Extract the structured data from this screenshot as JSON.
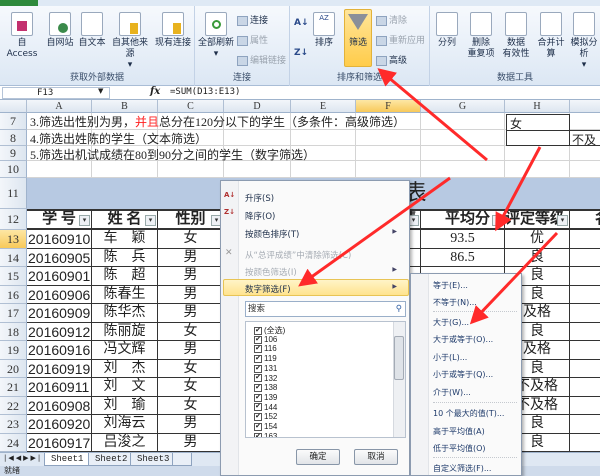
{
  "accent": {
    "arrow": "#ff2a2a",
    "highlight": "#ffe38e",
    "title_band": "#b7c9e2"
  },
  "ribbon": {
    "groups": [
      {
        "label": "获取外部数据",
        "buttons": [
          "自 Access",
          "自网站",
          "自文本",
          "自其他来源"
        ],
        "extra": "现有连接"
      },
      {
        "label": "连接",
        "buttons": [
          "全部刷新"
        ],
        "small": [
          "连接",
          "属性",
          "编辑链接"
        ]
      },
      {
        "label": "排序和筛选",
        "buttons": [
          "排序",
          "筛选"
        ],
        "small": [
          "清除",
          "重新应用",
          "高级"
        ]
      },
      {
        "label": "数据工具",
        "buttons": [
          "分列",
          "删除\n重复项",
          "数据\n有效性",
          "合并计算",
          "模拟分析"
        ]
      }
    ]
  },
  "formula_bar": {
    "name_box": "F13",
    "fx": "fx",
    "formula": "=SUM(D13:E13)"
  },
  "columns": [
    "A",
    "B",
    "C",
    "D",
    "E",
    "F",
    "G",
    "H",
    "I"
  ],
  "selected_column": "F",
  "notes": [
    {
      "row": "7",
      "parts": [
        "3.筛选出性别为男，",
        "并且",
        "总分在120分以下的学生（多条件：高级筛选）"
      ]
    },
    {
      "row": "8",
      "parts": [
        "4.筛选出姓陈的学生（文本筛选）"
      ]
    },
    {
      "row": "9",
      "parts": [
        "5.筛选出机试成绩在80到90分之间的学生（数字筛选）"
      ]
    }
  ],
  "side_cells": {
    "h7": "女",
    "i8": "不及"
  },
  "table": {
    "title": "成绩表",
    "headers": [
      "学 号",
      "姓 名",
      "性别",
      "",
      "",
      "总评成绩",
      "平均分",
      "评定等级",
      "名次"
    ],
    "rows": [
      {
        "n": "13",
        "id": "20160910",
        "name": "车　颖",
        "sex": "女",
        "avg": "93.5",
        "grade": "优",
        "rank": ""
      },
      {
        "n": "14",
        "id": "20160905",
        "name": "陈　兵",
        "sex": "男",
        "avg": "86.5",
        "grade": "良",
        "rank": ""
      },
      {
        "n": "15",
        "id": "20160901",
        "name": "陈　超",
        "sex": "男",
        "avg": "",
        "grade": "良",
        "rank": ""
      },
      {
        "n": "16",
        "id": "20160906",
        "name": "陈春生",
        "sex": "男",
        "avg": "",
        "grade": "良",
        "rank": "1"
      },
      {
        "n": "17",
        "id": "20160909",
        "name": "陈华杰",
        "sex": "男",
        "avg": "",
        "grade": "及格",
        "rank": "1"
      },
      {
        "n": "18",
        "id": "20160912",
        "name": "陈丽旋",
        "sex": "女",
        "avg": "",
        "grade": "良",
        "rank": ""
      },
      {
        "n": "19",
        "id": "20160916",
        "name": "冯文辉",
        "sex": "男",
        "avg": "",
        "grade": "及格",
        "rank": "1"
      },
      {
        "n": "20",
        "id": "20160919",
        "name": "刘　杰",
        "sex": "女",
        "avg": "",
        "grade": "良",
        "rank": "1"
      },
      {
        "n": "21",
        "id": "20160911",
        "name": "刘　文",
        "sex": "女",
        "avg": "",
        "grade": "不及格",
        "rank": "2"
      },
      {
        "n": "22",
        "id": "20160908",
        "name": "刘　瑜",
        "sex": "女",
        "avg": "",
        "grade": "不及格",
        "rank": "1"
      },
      {
        "n": "23",
        "id": "20160920",
        "name": "刘海云",
        "sex": "男",
        "avg": "",
        "grade": "良",
        "rank": ""
      },
      {
        "n": "24",
        "id": "20160917",
        "name": "吕浚之",
        "sex": "男",
        "avg": "",
        "grade": "良",
        "rank": ""
      }
    ]
  },
  "filter_menu": {
    "items": [
      {
        "label": "升序(S)",
        "icon": "sort-asc-icon"
      },
      {
        "label": "降序(O)",
        "icon": "sort-desc-icon"
      },
      {
        "label": "按颜色排序(T)",
        "submenu": true
      },
      {
        "label": "从“总评成绩”中清除筛选(C)",
        "disabled": true,
        "icon": "clear-filter-icon"
      },
      {
        "label": "按颜色筛选(I)",
        "disabled": true,
        "submenu": true
      },
      {
        "label": "数字筛选(F)",
        "submenu": true,
        "highlighted": true
      }
    ],
    "search_placeholder": "搜索",
    "values": [
      "(全选)",
      "106",
      "116",
      "119",
      "131",
      "132",
      "138",
      "139",
      "144",
      "152",
      "154",
      "163"
    ],
    "ok": "确定",
    "cancel": "取消"
  },
  "number_filter_submenu": [
    "等于(E)...",
    "不等于(N)...",
    "大于(G)...",
    "大于或等于(O)...",
    "小于(L)...",
    "小于或等于(Q)...",
    "介于(W)...",
    "10 个最大的值(T)...",
    "高于平均值(A)",
    "低于平均值(O)",
    "自定义筛选(F)..."
  ],
  "sheets": [
    "Sheet1",
    "Sheet2",
    "Sheet3"
  ],
  "active_sheet": "Sheet1",
  "status": "就绪"
}
